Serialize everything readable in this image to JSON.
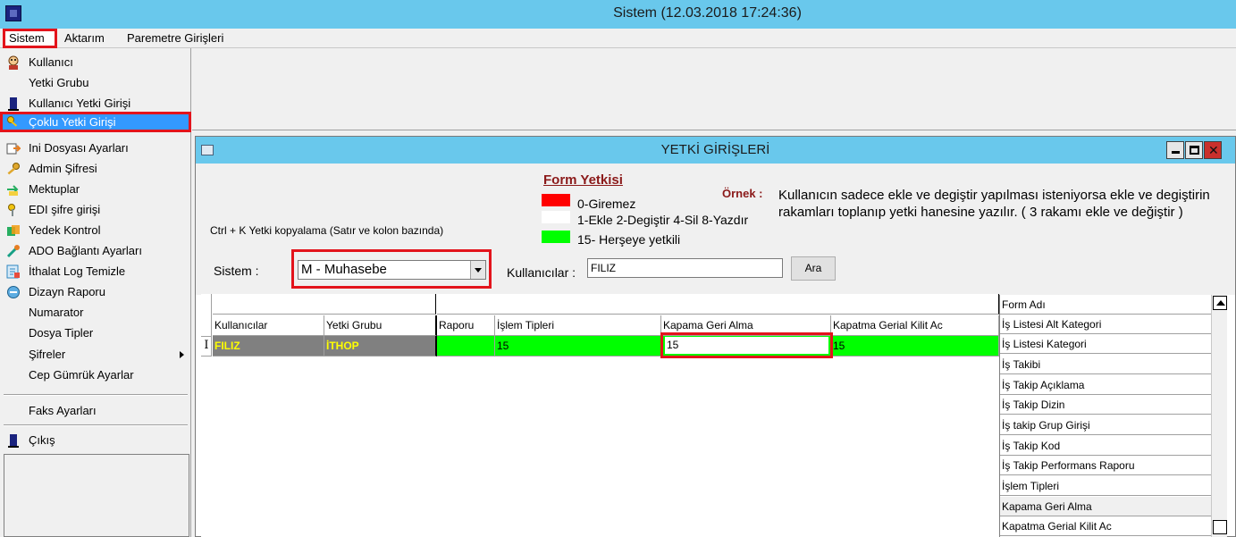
{
  "window": {
    "title": "Sistem (12.03.2018 17:24:36)"
  },
  "menubar": {
    "items": [
      "Sistem",
      "Aktarım",
      "Paremetre Girişleri"
    ]
  },
  "dropdown": {
    "items": [
      {
        "label": "Kullanıcı",
        "icon": "user-icon"
      },
      {
        "label": "Yetki Grubu",
        "icon": ""
      },
      {
        "label": "Kullanıcı Yetki Girişi",
        "icon": "door-icon"
      },
      {
        "label": "Çoklu Yetki Girişi",
        "icon": "keys-icon"
      },
      {
        "label": "Ini Dosyası Ayarları",
        "icon": "ini-file-icon"
      },
      {
        "label": "Admin Şifresi",
        "icon": "key-icon"
      },
      {
        "label": "Mektuplar",
        "icon": "letters-icon"
      },
      {
        "label": "EDI şifre girişi",
        "icon": "edi-key-icon"
      },
      {
        "label": "Yedek Kontrol",
        "icon": "backup-icon"
      },
      {
        "label": "ADO Bağlantı Ayarları",
        "icon": "connection-icon"
      },
      {
        "label": "İthalat Log Temizle",
        "icon": "log-clean-icon"
      },
      {
        "label": "Dizayn Raporu",
        "icon": "report-icon"
      },
      {
        "label": "Numarator",
        "icon": ""
      },
      {
        "label": "Dosya Tipler",
        "icon": ""
      },
      {
        "label": "Şifreler",
        "icon": ""
      },
      {
        "label": "Cep Gümrük Ayarlar",
        "icon": ""
      },
      {
        "label": "Faks Ayarları",
        "icon": ""
      },
      {
        "label": "Çıkış",
        "icon": "exit-door-icon"
      }
    ]
  },
  "child": {
    "title": "YETKİ GİRİŞLERİ",
    "ctrl_hint": "Ctrl + K Yetki kopyalama (Satır ve kolon bazında)",
    "form_yetkisi": {
      "title": "Form Yetkisi",
      "line1": "0-Giremez",
      "line2": "1-Ekle  2-Degiştir  4-Sil  8-Yazdır",
      "line3": "15- Herşeye yetkili",
      "colors": {
        "red": "#ff0000",
        "white": "#ffffff",
        "green": "#00ff00"
      }
    },
    "ornek_label": "Örnek :",
    "ornek_desc": "Kullanıcın sadece ekle ve degiştir yapılması isteniyorsa  ekle ve degiştirin rakamları toplanıp yetki hanesine yazılır.  ( 3 rakamı ekle ve değiştir )",
    "sistem_label": "Sistem :",
    "sistem_value": "M - Muhasebe",
    "kullanicilar_label": "Kullanıcılar :",
    "kullanicilar_value": "FILIZ",
    "ara_label": "Ara",
    "grid": {
      "headers": [
        "Kullanıcılar",
        "Yetki Grubu",
        "Raporu",
        "İşlem Tipleri",
        "Kapama Geri Alma",
        "Kapatma Gerial Kilit Ac"
      ],
      "row_indicator": "I",
      "row": [
        "FILIZ",
        "İTHOP",
        "",
        "15",
        "15",
        "15"
      ]
    },
    "form_list": {
      "header": "Form Adı",
      "items": [
        "İş Listesi Alt Kategori",
        "İş Listesi Kategori",
        "İş Takibi",
        "İş Takip Açıklama",
        "İş Takip Dizin",
        "İş takip Grup Girişi",
        "İş Takip Kod",
        "İş Takip Performans Raporu",
        "İşlem Tipleri",
        "Kapama Geri Alma",
        "Kapatma Gerial Kilit Ac"
      ]
    }
  }
}
